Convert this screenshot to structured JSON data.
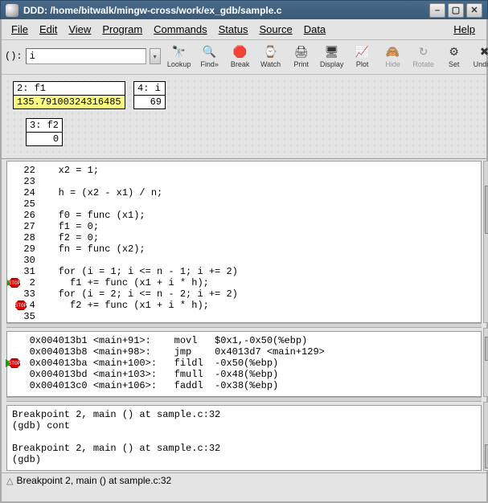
{
  "title": "DDD: /home/bitwalk/mingw-cross/work/ex_gdb/sample.c",
  "menu": {
    "file": "File",
    "edit": "Edit",
    "view": "View",
    "program": "Program",
    "commands": "Commands",
    "status": "Status",
    "source": "Source",
    "data": "Data",
    "help": "Help"
  },
  "arg": {
    "label": "():",
    "value": "i"
  },
  "toolbar": {
    "lookup": "Lookup",
    "find": "Find»",
    "break": "Break",
    "watch": "Watch",
    "print": "Print",
    "display": "Display",
    "plot": "Plot",
    "hide": "Hide",
    "rotate": "Rotate",
    "set": "Set",
    "undisp": "Undisp"
  },
  "displays": {
    "f1": {
      "title": "2: f1",
      "value": "135.79100324316485"
    },
    "i": {
      "title": "4: i",
      "value": "69"
    },
    "f2": {
      "title": "3: f2",
      "value": "0"
    }
  },
  "source": {
    "lines": [
      "  22    x2 = 1;",
      "  23",
      "  24    h = (x2 - x1) / n;",
      "  25",
      "  26    f0 = func (x1);",
      "  27    f1 = 0;",
      "  28    f2 = 0;",
      "  29    fn = func (x2);",
      "  30",
      "  31    for (i = 1; i <= n - 1; i += 2)",
      "   2      f1 += func (x1 + i * h);",
      "  33    for (i = 2; i <= n - 2; i += 2)",
      "   4      f2 += func (x1 + i * h);",
      "  35"
    ]
  },
  "asm": {
    "lines": [
      "   0x004013b1 <main+91>:    movl   $0x1,-0x50(%ebp)",
      "   0x004013b8 <main+98>:    jmp    0x4013d7 <main+129>",
      "   0x004013ba <main+100>:   fildl  -0x50(%ebp)",
      "   0x004013bd <main+103>:   fmull  -0x48(%ebp)",
      "   0x004013c0 <main+106>:   faddl  -0x38(%ebp)"
    ]
  },
  "gdb": {
    "lines": [
      "Breakpoint 2, main () at sample.c:32",
      "(gdb) cont",
      "",
      "Breakpoint 2, main () at sample.c:32",
      "(gdb) "
    ]
  },
  "status": "Breakpoint 2, main () at sample.c:32"
}
